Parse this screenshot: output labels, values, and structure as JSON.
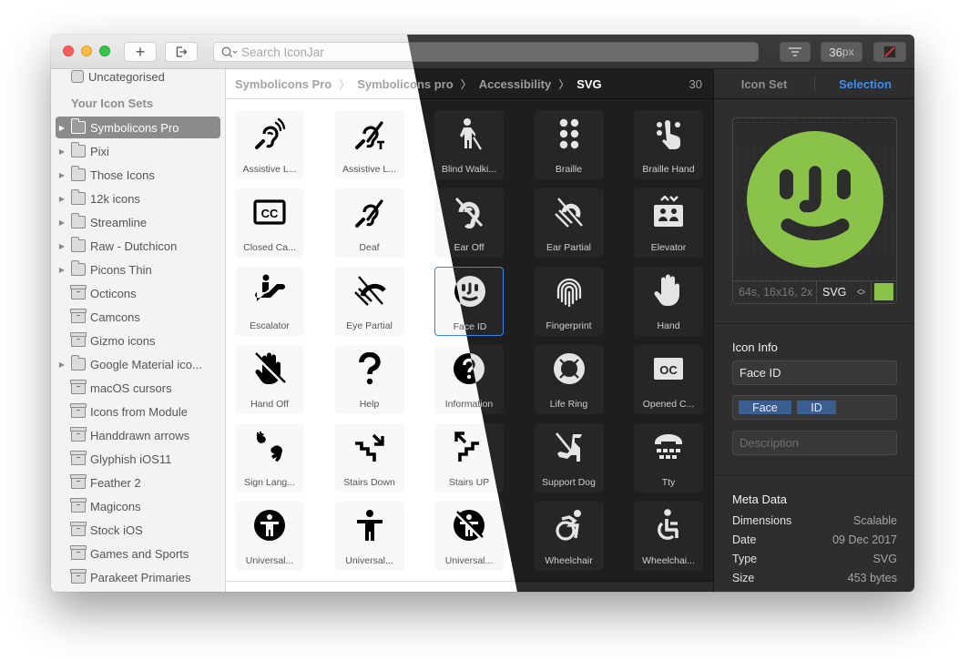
{
  "toolbar": {
    "add_label": "+",
    "export_label": "⇥",
    "search_placeholder": "Search IconJar",
    "search_icon": "⌕",
    "filter_icon": "filter-lines-icon",
    "size_value": "36",
    "size_unit": "px",
    "background_icon": "no-background-slash-icon"
  },
  "sidebar": {
    "uncategorised": "Uncategorised",
    "section_title": "Your Icon Sets",
    "items": [
      {
        "label": "Symbolicons Pro",
        "type": "folder",
        "expandable": true,
        "selected": true
      },
      {
        "label": "Pixi",
        "type": "folder",
        "expandable": true
      },
      {
        "label": "Those Icons",
        "type": "folder",
        "expandable": true
      },
      {
        "label": "12k icons",
        "type": "folder",
        "expandable": true
      },
      {
        "label": "Streamline",
        "type": "folder",
        "expandable": true
      },
      {
        "label": "Raw - Dutchicon",
        "type": "folder",
        "expandable": true
      },
      {
        "label": "Picons Thin",
        "type": "folder",
        "expandable": true
      },
      {
        "label": "Octicons",
        "type": "box"
      },
      {
        "label": "Camcons",
        "type": "box"
      },
      {
        "label": "Gizmo icons",
        "type": "box"
      },
      {
        "label": "Google Material ico...",
        "type": "folder",
        "expandable": true
      },
      {
        "label": "macOS cursors",
        "type": "box"
      },
      {
        "label": "Icons from Module",
        "type": "box"
      },
      {
        "label": "Handdrawn arrows",
        "type": "box"
      },
      {
        "label": "Glyphish iOS11",
        "type": "box"
      },
      {
        "label": "Feather 2",
        "type": "box"
      },
      {
        "label": "Magicons",
        "type": "box"
      },
      {
        "label": "Stock iOS",
        "type": "box"
      },
      {
        "label": "Games and Sports",
        "type": "box"
      },
      {
        "label": "Parakeet Primaries",
        "type": "box"
      }
    ]
  },
  "breadcrumb": {
    "items": [
      "Symbolicons Pro",
      "Symbolicons pro",
      "Accessibility",
      "SVG"
    ],
    "separator": "〉",
    "count": "30"
  },
  "icons": [
    {
      "label": "Assistive L...",
      "icon": "assistive-listening-icon"
    },
    {
      "label": "Assistive L...",
      "icon": "assistive-listening-t-icon"
    },
    {
      "label": "Blind Walki...",
      "icon": "blind-walking-icon"
    },
    {
      "label": "Braille",
      "icon": "braille-icon"
    },
    {
      "label": "Braille Hand",
      "icon": "braille-hand-icon"
    },
    {
      "label": "Closed Ca...",
      "icon": "closed-captions-icon"
    },
    {
      "label": "Deaf",
      "icon": "deaf-icon"
    },
    {
      "label": "Ear Off",
      "icon": "ear-off-icon"
    },
    {
      "label": "Ear Partial",
      "icon": "ear-partial-icon"
    },
    {
      "label": "Elevator",
      "icon": "elevator-icon"
    },
    {
      "label": "Escalator",
      "icon": "escalator-icon"
    },
    {
      "label": "Eye Partial",
      "icon": "eye-partial-icon"
    },
    {
      "label": "Face ID",
      "icon": "face-id-icon",
      "selected": true
    },
    {
      "label": "Fingerprint",
      "icon": "fingerprint-icon"
    },
    {
      "label": "Hand",
      "icon": "hand-icon"
    },
    {
      "label": "Hand Off",
      "icon": "hand-off-icon"
    },
    {
      "label": "Help",
      "icon": "help-icon"
    },
    {
      "label": "Information",
      "icon": "information-icon"
    },
    {
      "label": "Life Ring",
      "icon": "life-ring-icon"
    },
    {
      "label": "Opened C...",
      "icon": "opened-captions-icon"
    },
    {
      "label": "Sign Lang...",
      "icon": "sign-language-icon"
    },
    {
      "label": "Stairs Down",
      "icon": "stairs-down-icon"
    },
    {
      "label": "Stairs UP",
      "icon": "stairs-up-icon"
    },
    {
      "label": "Support Dog",
      "icon": "support-dog-icon"
    },
    {
      "label": "Tty",
      "icon": "tty-icon"
    },
    {
      "label": "Universal...",
      "icon": "universal-access-circle-icon"
    },
    {
      "label": "Universal...",
      "icon": "universal-access-icon"
    },
    {
      "label": "Universal...",
      "icon": "universal-access-off-icon"
    },
    {
      "label": "Wheelchair",
      "icon": "wheelchair-active-icon"
    },
    {
      "label": "Wheelchai...",
      "icon": "wheelchair-icon"
    }
  ],
  "panel": {
    "tabs": [
      {
        "label": "Icon Set"
      },
      {
        "label": "Selection",
        "active": true
      }
    ],
    "preview": {
      "sizes_placeholder": "64s, 16x16, 2x",
      "format": "SVG",
      "color": "#8bc34a"
    },
    "icon_info": {
      "title": "Icon Info",
      "name": "Face ID",
      "tags": [
        "Face",
        "ID"
      ],
      "description_placeholder": "Description"
    },
    "meta": {
      "title": "Meta Data",
      "rows": [
        {
          "key": "Dimensions",
          "value": "Scalable"
        },
        {
          "key": "Date",
          "value": "09 Dec 2017"
        },
        {
          "key": "Type",
          "value": "SVG"
        },
        {
          "key": "Size",
          "value": "453 bytes"
        }
      ]
    }
  },
  "colors": {
    "accent": "#3f8ef1",
    "selection_outline": "#3b82f0",
    "preview_icon": "#8bc34a",
    "tag": "#3b5d8f"
  }
}
